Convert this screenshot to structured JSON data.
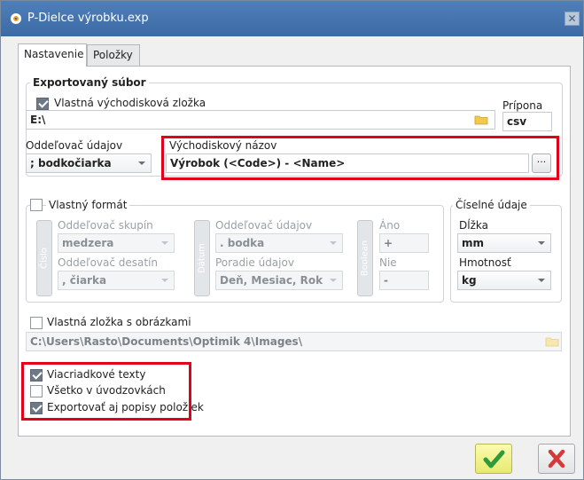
{
  "window": {
    "title": "P-Dielce výrobku.exp"
  },
  "tabs": [
    "Nastavenie",
    "Položky"
  ],
  "export_group": {
    "title": "Exportovaný súbor",
    "custom_folder": {
      "label": "Vlastná východisková zložka",
      "checked": true
    },
    "path_value": "E:\\",
    "extension": {
      "label": "Prípona",
      "value": "csv"
    },
    "data_separator": {
      "label": "Oddeľovač údajov",
      "value": "; bodkočiarka"
    },
    "default_name": {
      "label": "Východiskový názov",
      "value": "Výrobok (<Code>) - <Name>",
      "button": "···"
    }
  },
  "format_group": {
    "checkbox_label": "Vlastný formát",
    "checked": false,
    "cislo": {
      "tab_label": "Číslo",
      "group_sep_label": "Oddeľovač skupín",
      "group_sep_value": "medzera",
      "decimal_sep_label": "Oddeľovač desatín",
      "decimal_sep_value": ", čiarka"
    },
    "datum": {
      "tab_label": "Dátum",
      "data_sep_label": "Oddeľovač údajov",
      "data_sep_value": ". bodka",
      "order_label": "Poradie údajov",
      "order_value": "Deň, Mesiac, Rok"
    },
    "boolean": {
      "tab_label": "Boolean",
      "yes_label": "Áno",
      "yes_value": "+",
      "no_label": "Nie",
      "no_value": "-"
    }
  },
  "numeric_group": {
    "title": "Číselné údaje",
    "length_label": "Dĺžka",
    "length_value": "mm",
    "weight_label": "Hmotnosť",
    "weight_value": "kg"
  },
  "images": {
    "checkbox_label": "Vlastná zložka s obrázkami",
    "checked": false,
    "path": "C:\\Users\\Rasto\\Documents\\Optimik 4\\Images\\"
  },
  "options": [
    {
      "label": "Viacriadkové texty",
      "checked": true
    },
    {
      "label": "Všetko v úvodzovkách",
      "checked": false
    },
    {
      "label": "Exportovať aj popisy položiek",
      "checked": true
    }
  ],
  "colors": {
    "highlight": "#e3001b",
    "titlebar": "#4472ad"
  }
}
